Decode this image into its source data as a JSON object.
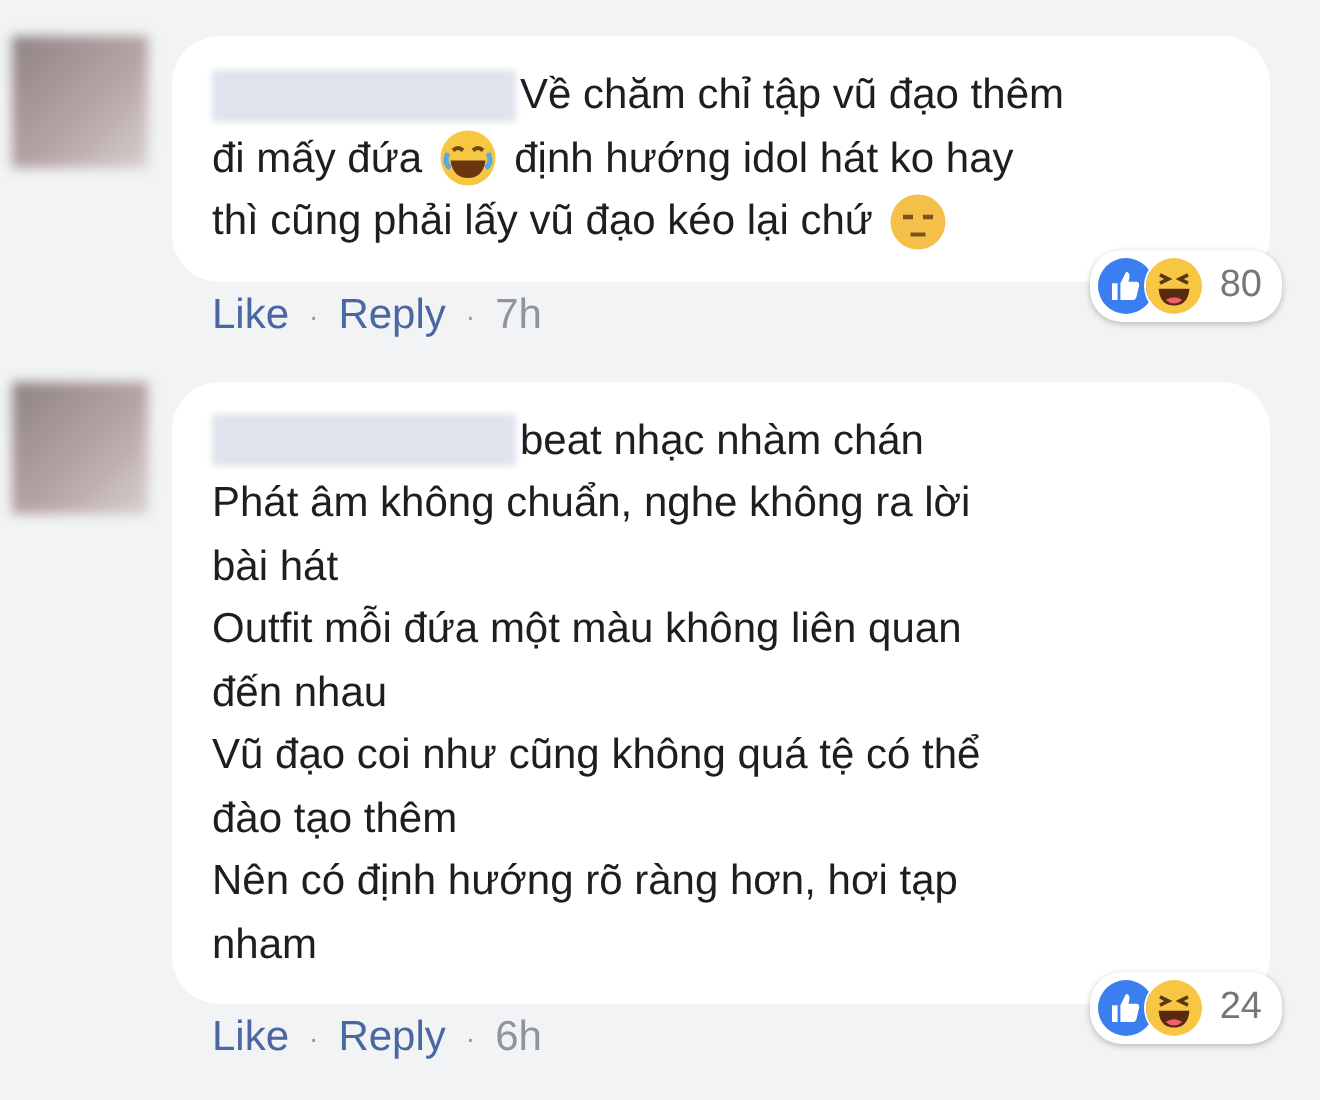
{
  "comments": [
    {
      "lines": [
        [
          {
            "kind": "text",
            "text": "Về chăm chỉ tập vũ đạo thêm"
          }
        ],
        [
          {
            "kind": "text",
            "text": "đi mấy đứa"
          },
          {
            "kind": "laugh"
          },
          {
            "kind": "text",
            "text": "định hướng idol hát ko hay"
          }
        ],
        [
          {
            "kind": "text",
            "text": "thì cũng phải lấy vũ đạo kéo lại chứ"
          },
          {
            "kind": "meh"
          }
        ]
      ],
      "reactions": {
        "count": "80"
      },
      "meta": [
        {
          "kind": "link",
          "text": "Like"
        },
        {
          "kind": "sep",
          "text": "·"
        },
        {
          "kind": "link",
          "text": "Reply"
        },
        {
          "kind": "sep",
          "text": "·"
        },
        {
          "kind": "time",
          "text": "7h"
        }
      ]
    },
    {
      "lines": [
        [
          {
            "kind": "text",
            "text": "beat nhạc nhàm chán"
          }
        ],
        [
          {
            "kind": "text",
            "text": "Phát âm không chuẩn, nghe không ra lời"
          }
        ],
        [
          {
            "kind": "text",
            "text": "bài hát"
          }
        ],
        [
          {
            "kind": "text",
            "text": "Outfit mỗi đứa một màu không liên quan"
          }
        ],
        [
          {
            "kind": "text",
            "text": "đến nhau"
          }
        ],
        [
          {
            "kind": "text",
            "text": "Vũ đạo coi như cũng không quá tệ có thể"
          }
        ],
        [
          {
            "kind": "text",
            "text": "đào tạo thêm"
          }
        ],
        [
          {
            "kind": "text",
            "text": "Nên có định hướng rõ ràng hơn, hơi tạp"
          }
        ],
        [
          {
            "kind": "text",
            "text": "nham"
          }
        ]
      ],
      "reactions": {
        "count": "24"
      },
      "meta": [
        {
          "kind": "link",
          "text": "Like"
        },
        {
          "kind": "sep",
          "text": "·"
        },
        {
          "kind": "link",
          "text": "Reply"
        },
        {
          "kind": "sep",
          "text": "·"
        },
        {
          "kind": "time",
          "text": "6h"
        }
      ]
    }
  ]
}
